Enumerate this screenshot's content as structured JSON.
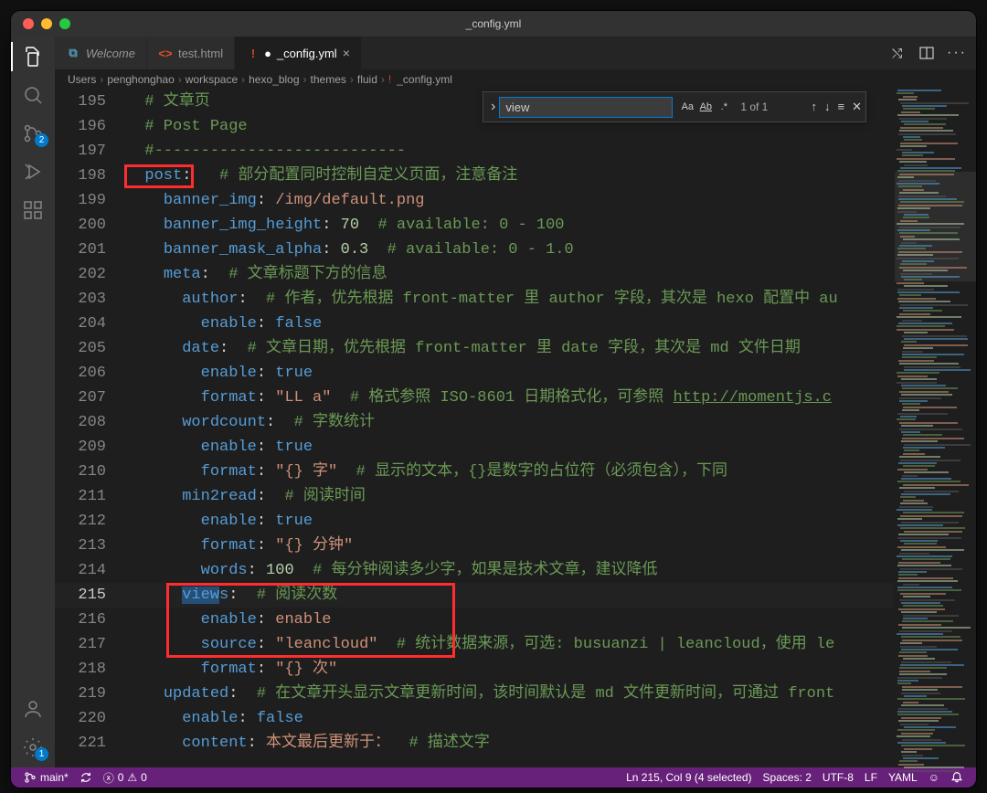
{
  "window_title": "_config.yml",
  "tabs": [
    {
      "icon": "vs",
      "label": "Welcome",
      "modified": false,
      "italic": true
    },
    {
      "icon": "html",
      "label": "test.html",
      "modified": false
    },
    {
      "icon": "yml",
      "label": "_config.yml",
      "modified": true,
      "active": true
    }
  ],
  "breadcrumb": [
    "Users",
    "penghonghao",
    "workspace",
    "hexo_blog",
    "themes",
    "fluid",
    "_config.yml"
  ],
  "breadcrumb_file_icon": "yml",
  "find": {
    "query": "view",
    "count": "1 of 1",
    "case": "Aa",
    "word": "Ab",
    "regex": ".*"
  },
  "activity_badges": {
    "scm": "2",
    "settings": "1"
  },
  "code_lines": [
    {
      "n": 195,
      "html": "  <span class='c-cmt'># 文章页</span>"
    },
    {
      "n": 196,
      "html": "  <span class='c-cmt'># Post Page</span>"
    },
    {
      "n": 197,
      "html": "  <span class='c-cmt'>#---------------------------</span>"
    },
    {
      "n": 198,
      "html": "  <span class='c-key'>post</span>:   <span class='c-cmt'># 部分配置同时控制自定义页面，注意备注</span>"
    },
    {
      "n": 199,
      "html": "    <span class='c-key'>banner_img</span>: <span class='c-str'>/img/default.png</span>"
    },
    {
      "n": 200,
      "html": "    <span class='c-key'>banner_img_height</span>: <span class='c-num'>70</span>  <span class='c-cmt'># available: 0 - 100</span>"
    },
    {
      "n": 201,
      "html": "    <span class='c-key'>banner_mask_alpha</span>: <span class='c-num'>0.3</span>  <span class='c-cmt'># available: 0 - 1.0</span>"
    },
    {
      "n": 202,
      "html": "    <span class='c-key'>meta</span>:  <span class='c-cmt'># 文章标题下方的信息</span>"
    },
    {
      "n": 203,
      "html": "      <span class='c-key'>author</span>:  <span class='c-cmt'># 作者，优先根据 front-matter 里 author 字段，其次是 hexo 配置中 au</span>"
    },
    {
      "n": 204,
      "html": "        <span class='c-key'>enable</span>: <span class='c-bool'>false</span>"
    },
    {
      "n": 205,
      "html": "      <span class='c-key'>date</span>:  <span class='c-cmt'># 文章日期，优先根据 front-matter 里 date 字段，其次是 md 文件日期</span>"
    },
    {
      "n": 206,
      "html": "        <span class='c-key'>enable</span>: <span class='c-bool'>true</span>"
    },
    {
      "n": 207,
      "html": "        <span class='c-key'>format</span>: <span class='c-str'>\"LL a\"</span>  <span class='c-cmt'># 格式参照 ISO-8601 日期格式化，可参照 <span class='url'>http://momentjs.c</span></span>"
    },
    {
      "n": 208,
      "html": "      <span class='c-key'>wordcount</span>:  <span class='c-cmt'># 字数统计</span>"
    },
    {
      "n": 209,
      "html": "        <span class='c-key'>enable</span>: <span class='c-bool'>true</span>"
    },
    {
      "n": 210,
      "html": "        <span class='c-key'>format</span>: <span class='c-str'>\"{} 字\"</span>  <span class='c-cmt'># 显示的文本，{}是数字的占位符（必须包含），下同</span>"
    },
    {
      "n": 211,
      "html": "      <span class='c-key'>min2read</span>:  <span class='c-cmt'># 阅读时间</span>"
    },
    {
      "n": 212,
      "html": "        <span class='c-key'>enable</span>: <span class='c-bool'>true</span>"
    },
    {
      "n": 213,
      "html": "        <span class='c-key'>format</span>: <span class='c-str'>\"{} 分钟\"</span>"
    },
    {
      "n": 214,
      "html": "        <span class='c-key'>words</span>: <span class='c-num'>100</span>  <span class='c-cmt'># 每分钟阅读多少字，如果是技术文章，建议降低</span>"
    },
    {
      "n": 215,
      "html": "      <span class='c-key'><span class='hl-sel'>view</span>s</span>:  <span class='c-cmt'># 阅读次数</span>",
      "current": true
    },
    {
      "n": 216,
      "html": "        <span class='c-key'>enable</span>: <span class='c-str'>enable</span>"
    },
    {
      "n": 217,
      "html": "        <span class='c-key'>source</span>: <span class='c-str'>\"leancloud\"</span>  <span class='c-cmt'># 统计数据来源，可选: busuanzi | leancloud，使用 le</span>"
    },
    {
      "n": 218,
      "html": "        <span class='c-key'>format</span>: <span class='c-str'>\"{} 次\"</span>"
    },
    {
      "n": 219,
      "html": "    <span class='c-key'>updated</span>:  <span class='c-cmt'># 在文章开头显示文章更新时间，该时间默认是 md 文件更新时间，可通过 front</span>"
    },
    {
      "n": 220,
      "html": "      <span class='c-key'>enable</span>: <span class='c-bool'>false</span>"
    },
    {
      "n": 221,
      "html": "      <span class='c-key'>content</span>: <span class='c-str'>本文最后更新于：</span>  <span class='c-cmt'># 描述文字</span>"
    }
  ],
  "status": {
    "branch": "main*",
    "errors": "0",
    "warnings": "0",
    "position": "Ln 215, Col 9 (4 selected)",
    "spaces": "Spaces: 2",
    "encoding": "UTF-8",
    "eol": "LF",
    "lang": "YAML"
  }
}
